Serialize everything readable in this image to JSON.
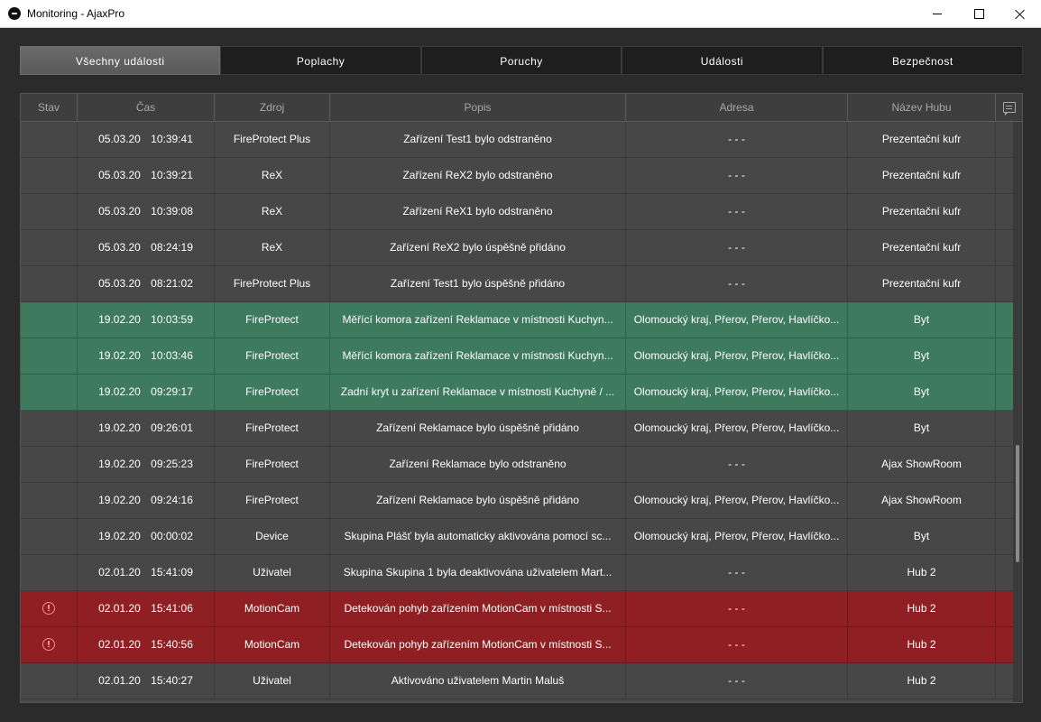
{
  "window": {
    "title": "Monitoring - AjaxPro"
  },
  "tabs": [
    {
      "label": "Všechny události",
      "active": true
    },
    {
      "label": "Poplachy",
      "active": false
    },
    {
      "label": "Poruchy",
      "active": false
    },
    {
      "label": "Události",
      "active": false
    },
    {
      "label": "Bezpečnost",
      "active": false
    }
  ],
  "table": {
    "headers": [
      "Stav",
      "Čas",
      "Zdroj",
      "Popis",
      "Adresa",
      "Název Hubu"
    ],
    "rows": [
      {
        "status": "",
        "time": "05.03.20 10:39:41",
        "source": "FireProtect Plus",
        "description": "Zařízení Test1 bylo odstraněno",
        "address": "- - -",
        "hub": "Prezentační kufr",
        "state": "normal"
      },
      {
        "status": "",
        "time": "05.03.20 10:39:21",
        "source": "ReX",
        "description": "Zařízení ReX2 bylo odstraněno",
        "address": "- - -",
        "hub": "Prezentační kufr",
        "state": "normal"
      },
      {
        "status": "",
        "time": "05.03.20 10:39:08",
        "source": "ReX",
        "description": "Zařízení ReX1 bylo odstraněno",
        "address": "- - -",
        "hub": "Prezentační kufr",
        "state": "normal"
      },
      {
        "status": "",
        "time": "05.03.20 08:24:19",
        "source": "ReX",
        "description": "Zařízení ReX2 bylo úspěšně přidáno",
        "address": "- - -",
        "hub": "Prezentační kufr",
        "state": "normal"
      },
      {
        "status": "",
        "time": "05.03.20 08:21:02",
        "source": "FireProtect Plus",
        "description": "Zařízení Test1 bylo úspěšně přidáno",
        "address": "- - -",
        "hub": "Prezentační kufr",
        "state": "normal"
      },
      {
        "status": "",
        "time": "19.02.20 10:03:59",
        "source": "FireProtect",
        "description": "Měřící komora zařízení Reklamace v místnosti Kuchyn...",
        "address": "Olomoucký kraj, Přerov, Přerov, Havlíčko...",
        "hub": "Byt",
        "state": "ok"
      },
      {
        "status": "",
        "time": "19.02.20 10:03:46",
        "source": "FireProtect",
        "description": "Měřící komora zařízení Reklamace v místnosti Kuchyn...",
        "address": "Olomoucký kraj, Přerov, Přerov, Havlíčko...",
        "hub": "Byt",
        "state": "ok"
      },
      {
        "status": "",
        "time": "19.02.20 09:29:17",
        "source": "FireProtect",
        "description": "Zadní kryt u zařízení Reklamace v místnosti Kuchyně / ...",
        "address": "Olomoucký kraj, Přerov, Přerov, Havlíčko...",
        "hub": "Byt",
        "state": "ok"
      },
      {
        "status": "",
        "time": "19.02.20 09:26:01",
        "source": "FireProtect",
        "description": "Zařízení Reklamace bylo úspěšně přidáno",
        "address": "Olomoucký kraj, Přerov, Přerov, Havlíčko...",
        "hub": "Byt",
        "state": "normal"
      },
      {
        "status": "",
        "time": "19.02.20 09:25:23",
        "source": "FireProtect",
        "description": "Zařízení Reklamace bylo odstraněno",
        "address": "- - -",
        "hub": "Ajax ShowRoom",
        "state": "normal"
      },
      {
        "status": "",
        "time": "19.02.20 09:24:16",
        "source": "FireProtect",
        "description": "Zařízení Reklamace bylo úspěšně přidáno",
        "address": "Olomoucký kraj, Přerov, Přerov, Havlíčko...",
        "hub": "Ajax ShowRoom",
        "state": "normal"
      },
      {
        "status": "",
        "time": "19.02.20 00:00:02",
        "source": "Device",
        "description": "Skupina Plášť byla automaticky aktivována pomocí sc...",
        "address": "Olomoucký kraj, Přerov, Přerov, Havlíčko...",
        "hub": "Byt",
        "state": "normal"
      },
      {
        "status": "",
        "time": "02.01.20 15:41:09",
        "source": "Uživatel",
        "description": "Skupina Skupina 1 byla deaktivována uživatelem Mart...",
        "address": "- - -",
        "hub": "Hub 2",
        "state": "normal"
      },
      {
        "status": "alert",
        "time": "02.01.20 15:41:06",
        "source": "MotionCam",
        "description": "Detekován pohyb zařízením MotionCam v místnosti S...",
        "address": "- - -",
        "hub": "Hub 2",
        "state": "alarm"
      },
      {
        "status": "alert",
        "time": "02.01.20 15:40:56",
        "source": "MotionCam",
        "description": "Detekován pohyb zařízením MotionCam v místnosti S...",
        "address": "- - -",
        "hub": "Hub 2",
        "state": "alarm"
      },
      {
        "status": "",
        "time": "02.01.20 15:40:27",
        "source": "Uživatel",
        "description": "Aktivováno uživatelem Martin Maluš",
        "address": "- - -",
        "hub": "Hub 2",
        "state": "normal"
      }
    ]
  },
  "colors": {
    "ok_row": "#3d7a5e",
    "alarm_row": "#8f1f22",
    "normal_row": "#474747"
  }
}
